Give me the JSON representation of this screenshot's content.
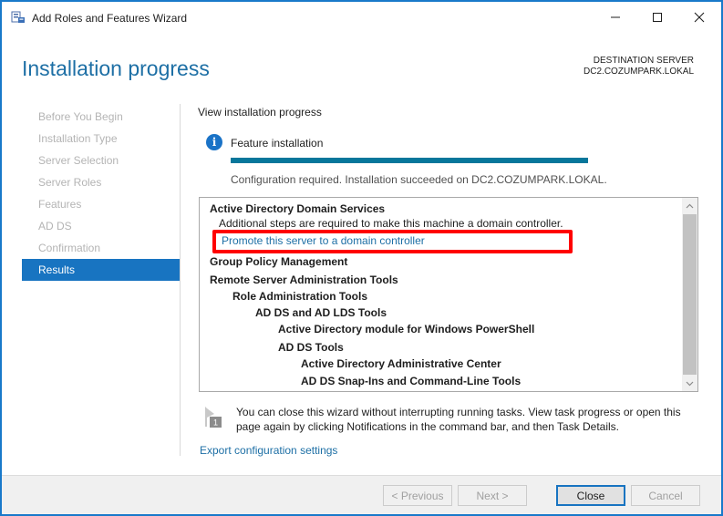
{
  "window": {
    "title": "Add Roles and Features Wizard"
  },
  "header": {
    "page_title": "Installation progress",
    "destination_label": "DESTINATION SERVER",
    "destination_value": "DC2.COZUMPARK.LOKAL"
  },
  "nav": {
    "items": [
      {
        "label": "Before You Begin",
        "active": false
      },
      {
        "label": "Installation Type",
        "active": false
      },
      {
        "label": "Server Selection",
        "active": false
      },
      {
        "label": "Server Roles",
        "active": false
      },
      {
        "label": "Features",
        "active": false
      },
      {
        "label": "AD DS",
        "active": false
      },
      {
        "label": "Confirmation",
        "active": false
      },
      {
        "label": "Results",
        "active": true
      }
    ]
  },
  "content": {
    "view_label": "View installation progress",
    "feature_label": "Feature installation",
    "progress_fraction": 1.0,
    "config_text": "Configuration required. Installation succeeded on DC2.COZUMPARK.LOKAL.",
    "results": [
      {
        "text": "Active Directory Domain Services",
        "style": "bold",
        "level": 0
      },
      {
        "text": "Additional steps are required to make this machine a domain controller.",
        "style": "normal",
        "level": 1
      },
      {
        "text": "Promote this server to a domain controller",
        "style": "link",
        "level": 1
      },
      {
        "text": "Group Policy Management",
        "style": "bold",
        "level": 0
      },
      {
        "text": "Remote Server Administration Tools",
        "style": "bold",
        "level": 0
      },
      {
        "text": "Role Administration Tools",
        "style": "bold",
        "level": 1
      },
      {
        "text": "AD DS and AD LDS Tools",
        "style": "bold",
        "level": 2
      },
      {
        "text": "Active Directory module for Windows PowerShell",
        "style": "bold",
        "level": 3
      },
      {
        "text": "AD DS Tools",
        "style": "bold",
        "level": 3
      },
      {
        "text": "Active Directory Administrative Center",
        "style": "bold",
        "level": 4
      },
      {
        "text": "AD DS Snap-Ins and Command-Line Tools",
        "style": "bold",
        "level": 4
      }
    ],
    "notice_badge": "1",
    "notice_text": "You can close this wizard without interrupting running tasks. View task progress or open this page again by clicking Notifications in the command bar, and then Task Details.",
    "export_link": "Export configuration settings"
  },
  "footer": {
    "previous_label": "< Previous",
    "next_label": "Next >",
    "close_label": "Close",
    "cancel_label": "Cancel"
  },
  "colors": {
    "accent": "#1874c1",
    "title_blue": "#1d6fa5",
    "progress": "#07779b",
    "highlight": "#ff0000"
  }
}
